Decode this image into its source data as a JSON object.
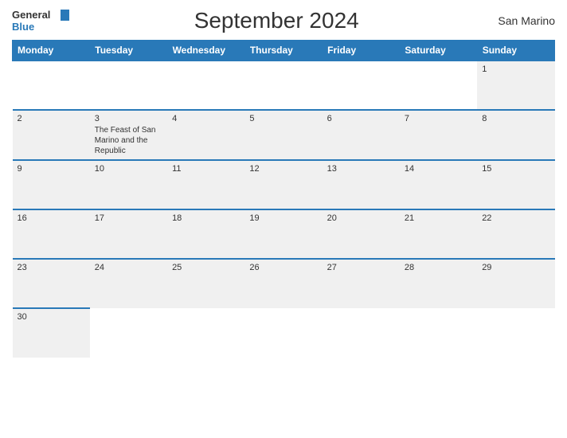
{
  "header": {
    "logo_general": "General",
    "logo_blue": "Blue",
    "title": "September 2024",
    "country": "San Marino"
  },
  "weekdays": [
    "Monday",
    "Tuesday",
    "Wednesday",
    "Thursday",
    "Friday",
    "Saturday",
    "Sunday"
  ],
  "weeks": [
    [
      {
        "day": "",
        "event": ""
      },
      {
        "day": "",
        "event": ""
      },
      {
        "day": "",
        "event": ""
      },
      {
        "day": "",
        "event": ""
      },
      {
        "day": "",
        "event": ""
      },
      {
        "day": "",
        "event": ""
      },
      {
        "day": "1",
        "event": ""
      }
    ],
    [
      {
        "day": "2",
        "event": ""
      },
      {
        "day": "3",
        "event": "The Feast of San Marino and the Republic"
      },
      {
        "day": "4",
        "event": ""
      },
      {
        "day": "5",
        "event": ""
      },
      {
        "day": "6",
        "event": ""
      },
      {
        "day": "7",
        "event": ""
      },
      {
        "day": "8",
        "event": ""
      }
    ],
    [
      {
        "day": "9",
        "event": ""
      },
      {
        "day": "10",
        "event": ""
      },
      {
        "day": "11",
        "event": ""
      },
      {
        "day": "12",
        "event": ""
      },
      {
        "day": "13",
        "event": ""
      },
      {
        "day": "14",
        "event": ""
      },
      {
        "day": "15",
        "event": ""
      }
    ],
    [
      {
        "day": "16",
        "event": ""
      },
      {
        "day": "17",
        "event": ""
      },
      {
        "day": "18",
        "event": ""
      },
      {
        "day": "19",
        "event": ""
      },
      {
        "day": "20",
        "event": ""
      },
      {
        "day": "21",
        "event": ""
      },
      {
        "day": "22",
        "event": ""
      }
    ],
    [
      {
        "day": "23",
        "event": ""
      },
      {
        "day": "24",
        "event": ""
      },
      {
        "day": "25",
        "event": ""
      },
      {
        "day": "26",
        "event": ""
      },
      {
        "day": "27",
        "event": ""
      },
      {
        "day": "28",
        "event": ""
      },
      {
        "day": "29",
        "event": ""
      }
    ],
    [
      {
        "day": "30",
        "event": ""
      },
      {
        "day": "",
        "event": ""
      },
      {
        "day": "",
        "event": ""
      },
      {
        "day": "",
        "event": ""
      },
      {
        "day": "",
        "event": ""
      },
      {
        "day": "",
        "event": ""
      },
      {
        "day": "",
        "event": ""
      }
    ]
  ]
}
